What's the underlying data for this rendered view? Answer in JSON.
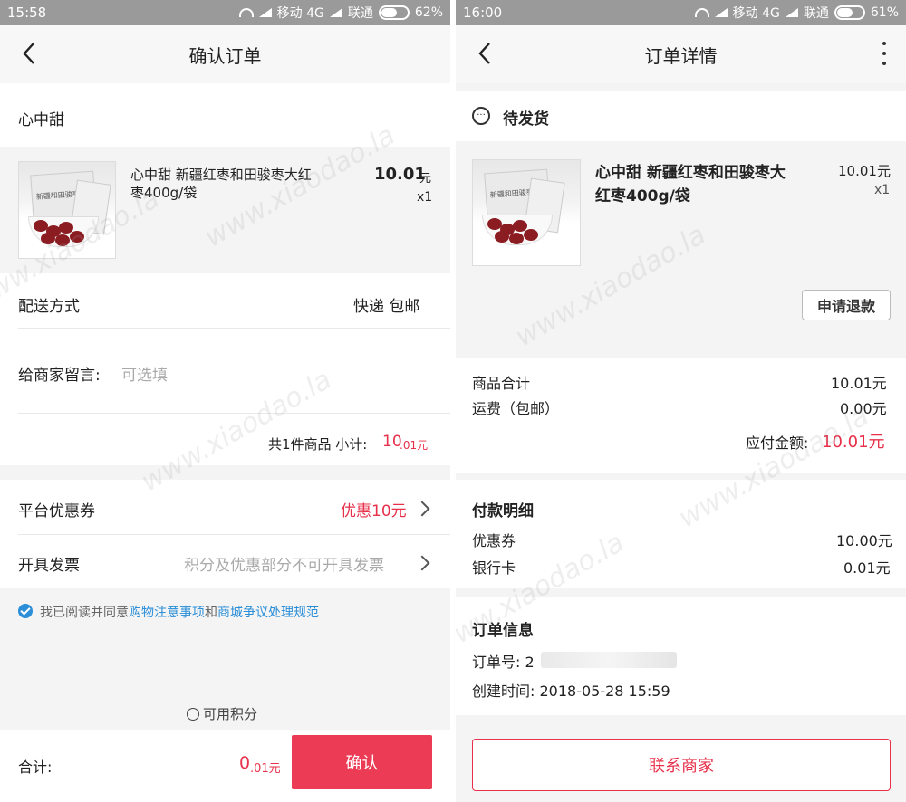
{
  "left": {
    "status": {
      "time": "15:58",
      "carrier1": "移动 4G",
      "carrier2": "联通",
      "battery": "62%",
      "battery_level": 0.62
    },
    "title": "确认订单",
    "shop_name": "心中甜",
    "product": {
      "name_line1": "心中甜  新疆红枣和田骏枣大红",
      "name_line2": "枣400g/袋",
      "price_int": "10.01",
      "price_unit": "元",
      "qty": "x1"
    },
    "image_labels": {
      "bag": "新疆和田骏枣"
    },
    "delivery": {
      "label": "配送方式",
      "value": "快递  包邮"
    },
    "message": {
      "label": "给商家留言:",
      "placeholder": "可选填"
    },
    "subtotal": {
      "prefix": "共1件商品  小计:",
      "int": "10",
      "dec": ".01元"
    },
    "coupon": {
      "label": "平台优惠券",
      "value": "优惠10元"
    },
    "invoice": {
      "label": "开具发票",
      "value": "积分及优惠部分不可开具发票"
    },
    "agreement": {
      "prefix": "我已阅读并同意",
      "link1": "购物注意事项",
      "mid": "和",
      "link2": "商城争议处理规范"
    },
    "points": "可用积分",
    "total": {
      "label": "合计:",
      "int": "0",
      "dec": ".01元"
    },
    "confirm": "确认"
  },
  "right": {
    "status": {
      "time": "16:00",
      "carrier1": "移动 4G",
      "carrier2": "联通",
      "battery": "61%",
      "battery_level": 0.61
    },
    "title": "订单详情",
    "order_status": "待发货",
    "product": {
      "name_line1": "心中甜 新疆红枣和田骏枣大",
      "name_line2": "红枣400g/袋",
      "price": "10.01元",
      "qty": "x1"
    },
    "refund": "申请退款",
    "summary": {
      "goods_total_label": "商品合计",
      "goods_total": "10.01元",
      "shipping_label": "运费（包邮）",
      "shipping": "0.00元",
      "payable_label": "应付金额:",
      "payable": "10.01元"
    },
    "payment": {
      "title": "付款明细",
      "coupon_label": "优惠券",
      "coupon": "10.00元",
      "card_label": "银行卡",
      "card": "0.01元"
    },
    "order_info": {
      "title": "订单信息",
      "number_label": "订单号: 2",
      "created_label": "创建时间: 2018-05-28 15:59"
    },
    "contact": "联系商家"
  },
  "watermark": "www.xiaodao.la"
}
